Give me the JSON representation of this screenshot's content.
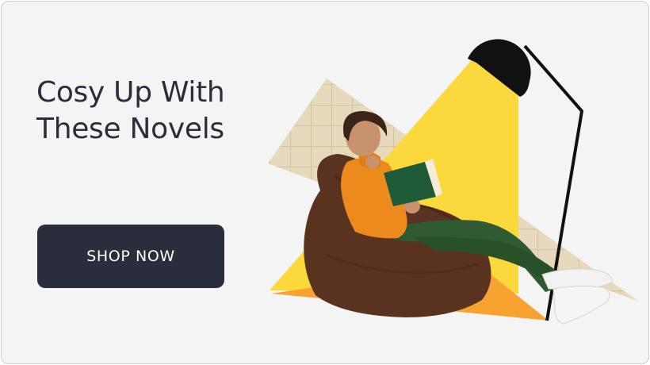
{
  "promo": {
    "headline_line1": "Cosy Up With",
    "headline_line2": "These Novels",
    "cta_label": "SHOP NOW"
  },
  "colors": {
    "background": "#f4f4f4",
    "headline_text": "#2a2e3b",
    "cta_background": "#2a2d3b",
    "cta_text": "#ffffff",
    "light_beam": "#fbd83c",
    "floor_triangle": "#f7a331",
    "tile_backdrop": "#e4d6bb",
    "sweater": "#ec8a1e",
    "trousers": "#2f5a32",
    "beanbag": "#5a3220",
    "book": "#1f5a38"
  },
  "illustration": {
    "subject": "woman reading a book in a beanbag chair under a floor lamp",
    "icons": [
      "floor-lamp-icon",
      "book-icon",
      "beanbag-chair-icon"
    ]
  }
}
